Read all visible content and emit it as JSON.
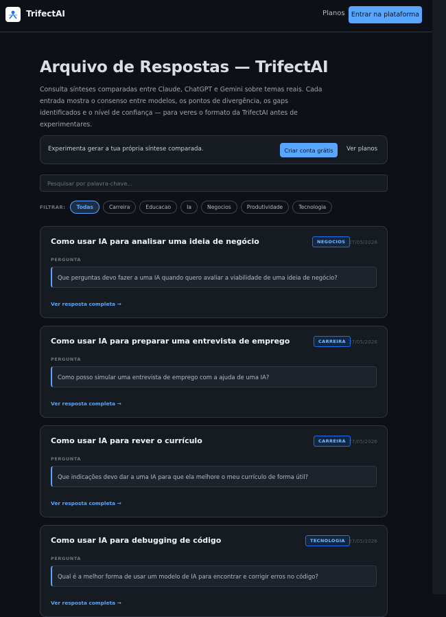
{
  "header": {
    "brand": "TrifectAI",
    "logo_icon": "trifectai-logo-icon",
    "nav_plans": "Planos",
    "nav_cta": "Entrar na plataforma"
  },
  "page": {
    "title": "Arquivo de Respostas — TrifectAI",
    "intro": "Consulta sínteses comparadas entre Claude, ChatGPT e Gemini sobre temas reais. Cada entrada mostra o consenso entre modelos, os pontos de divergência, os gaps identificados e o nível de confiança — para veres o formato da TrifectAI antes de experimentares."
  },
  "cta": {
    "text": "Experimenta gerar a tua própria síntese comparada.",
    "button": "Criar conta grátis",
    "link": "Ver planos"
  },
  "search": {
    "placeholder": "Pesquisar por palavra-chave..."
  },
  "filters": {
    "label": "FILTRAR:",
    "chips": [
      "Todas",
      "Carreira",
      "Educacao",
      "Ia",
      "Negocios",
      "Produtividade",
      "Tecnologia"
    ],
    "active": "Todas"
  },
  "cards": [
    {
      "title": "Como usar IA para analisar uma ideia de negócio",
      "tag": "NEGOCIOS",
      "date": "27/05/2026",
      "label": "PERGUNTA",
      "question": "Que perguntas devo fazer a uma IA quando quero avaliar a viabilidade de uma ideia de negócio?",
      "link": "Ver resposta completa →"
    },
    {
      "title": "Como usar IA para preparar uma entrevista de emprego",
      "tag": "CARREIRA",
      "date": "27/05/2026",
      "label": "PERGUNTA",
      "question": "Como posso simular uma entrevista de emprego com a ajuda de uma IA?",
      "link": "Ver resposta completa →"
    },
    {
      "title": "Como usar IA para rever o currículo",
      "tag": "CARREIRA",
      "date": "27/05/2026",
      "label": "PERGUNTA",
      "question": "Que indicações devo dar a uma IA para que ela melhore o meu currículo de forma útil?",
      "link": "Ver resposta completa →"
    },
    {
      "title": "Como usar IA para debugging de código",
      "tag": "TECNOLOGIA",
      "date": "27/05/2026",
      "label": "PERGUNTA",
      "question": "Qual é a melhor forma de usar um modelo de IA para encontrar e corrigir erros no código?",
      "link": "Ver resposta completa →"
    }
  ],
  "colors": {
    "background": "#0d1117",
    "accent": "#58a6ff",
    "card": "#161b22",
    "border": "#30363d"
  }
}
